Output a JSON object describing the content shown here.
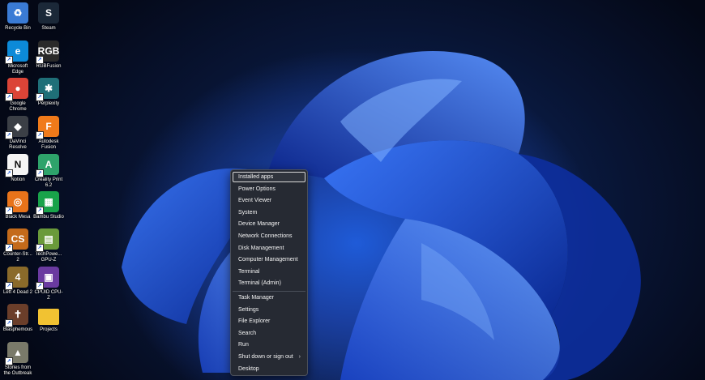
{
  "desktop_icons": [
    {
      "id": "recycle-bin",
      "label": "Recycle Bin",
      "color": "#3a7bd5",
      "glyph": "♻",
      "shortcut": false
    },
    {
      "id": "steam",
      "label": "Steam",
      "color": "#1b2838",
      "glyph": "S",
      "shortcut": false
    },
    {
      "id": "microsoft-edge",
      "label": "Microsoft Edge",
      "color": "#0c8ad8",
      "glyph": "e",
      "shortcut": true
    },
    {
      "id": "rgbfusion",
      "label": "RGBFusion",
      "color": "#2a2a2a",
      "glyph": "RGB",
      "shortcut": true
    },
    {
      "id": "google-chrome",
      "label": "Google Chrome",
      "color": "#db4437",
      "glyph": "●",
      "shortcut": true
    },
    {
      "id": "perplexity",
      "label": "Perplexity",
      "color": "#1f6f78",
      "glyph": "✱",
      "shortcut": true
    },
    {
      "id": "davinci-resolve",
      "label": "DaVinci Resolve",
      "color": "#3b3f46",
      "glyph": "◆",
      "shortcut": true
    },
    {
      "id": "autodesk-fusion",
      "label": "Autodesk Fusion",
      "color": "#f07a1a",
      "glyph": "F",
      "shortcut": true
    },
    {
      "id": "notion",
      "label": "Notion",
      "color": "#f5f5f5",
      "glyph": "N",
      "shortcut": true
    },
    {
      "id": "creality-print",
      "label": "Creality Print 6.2",
      "color": "#2ea36b",
      "glyph": "A",
      "shortcut": true
    },
    {
      "id": "black-mesa",
      "label": "Black Mesa",
      "color": "#e8731a",
      "glyph": "◎",
      "shortcut": true
    },
    {
      "id": "bambu-studio",
      "label": "Bambu Studio",
      "color": "#19a34a",
      "glyph": "▦",
      "shortcut": true
    },
    {
      "id": "counter-strike-2",
      "label": "Counter-Str... 2",
      "color": "#c46a1a",
      "glyph": "CS",
      "shortcut": true
    },
    {
      "id": "techpowerup-gpu-z",
      "label": "TechPowe... GPU-Z",
      "color": "#6a9a3a",
      "glyph": "▤",
      "shortcut": true
    },
    {
      "id": "left-4-dead-2",
      "label": "Left 4 Dead 2",
      "color": "#8a6a2a",
      "glyph": "4",
      "shortcut": true
    },
    {
      "id": "cpuid-cpu-z",
      "label": "CPUID CPU-Z",
      "color": "#6a3aa0",
      "glyph": "▣",
      "shortcut": true
    },
    {
      "id": "blasphemous",
      "label": "Blasphemous",
      "color": "#6b3e2a",
      "glyph": "✝",
      "shortcut": true
    },
    {
      "id": "projects",
      "label": "Projects",
      "color": "#f1c232",
      "glyph": "",
      "shortcut": false
    },
    {
      "id": "stories-from-the-outbreak",
      "label": "Stories from the Outbreak",
      "color": "#7a7a6a",
      "glyph": "▲",
      "shortcut": true
    }
  ],
  "winx_menu": {
    "items": [
      {
        "id": "installed-apps",
        "label": "Installed apps",
        "highlighted": true
      },
      {
        "id": "power-options",
        "label": "Power Options"
      },
      {
        "id": "event-viewer",
        "label": "Event Viewer"
      },
      {
        "id": "system",
        "label": "System"
      },
      {
        "id": "device-manager",
        "label": "Device Manager"
      },
      {
        "id": "network-connections",
        "label": "Network Connections"
      },
      {
        "id": "disk-management",
        "label": "Disk Management"
      },
      {
        "id": "computer-management",
        "label": "Computer Management"
      },
      {
        "id": "terminal",
        "label": "Terminal"
      },
      {
        "id": "terminal-admin",
        "label": "Terminal (Admin)",
        "separator_after": true
      },
      {
        "id": "task-manager",
        "label": "Task Manager"
      },
      {
        "id": "settings",
        "label": "Settings"
      },
      {
        "id": "file-explorer",
        "label": "File Explorer"
      },
      {
        "id": "search",
        "label": "Search"
      },
      {
        "id": "run",
        "label": "Run"
      },
      {
        "id": "shut-down-or-sign-out",
        "label": "Shut down or sign out",
        "submenu": true,
        "submenu_icon": "chevron-right-icon"
      },
      {
        "id": "desktop",
        "label": "Desktop"
      }
    ]
  },
  "colors": {
    "menu_bg": "#262a33",
    "menu_text": "#f2f2f2",
    "wallpaper_accent": "#1f5bd8"
  }
}
